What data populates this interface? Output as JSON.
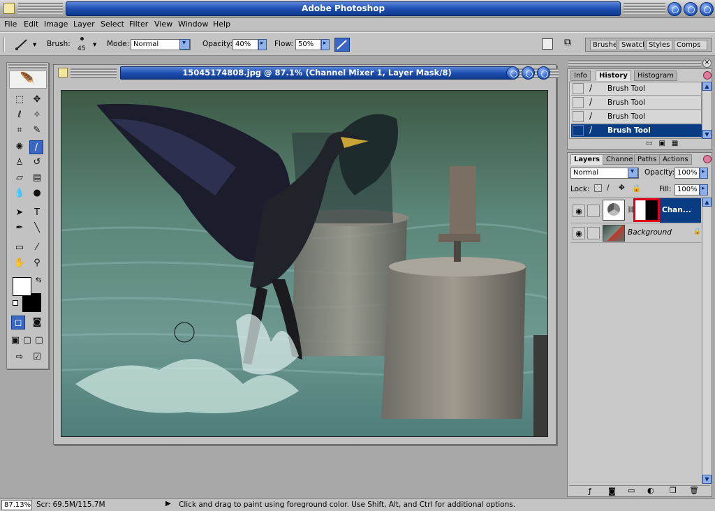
{
  "app": {
    "title": "Adobe Photoshop"
  },
  "menu": [
    "File",
    "Edit",
    "Image",
    "Layer",
    "Select",
    "Filter",
    "View",
    "Window",
    "Help"
  ],
  "options": {
    "brush_label": "Brush:",
    "brush_size": "45",
    "mode_label": "Mode:",
    "mode_value": "Normal",
    "opacity_label": "Opacity:",
    "opacity_value": "40%",
    "flow_label": "Flow:",
    "flow_value": "50%",
    "palette_tabs": [
      "Brushes",
      "Swatch",
      "Styles",
      "Comps"
    ]
  },
  "document": {
    "title": "15045174808.jpg @ 87.1% (Channel Mixer 1, Layer Mask/8)"
  },
  "history_panel": {
    "tabs": [
      "Info",
      "History",
      "Histogram"
    ],
    "items": [
      "Brush Tool",
      "Brush Tool",
      "Brush Tool",
      "Brush Tool"
    ]
  },
  "layers_panel": {
    "tabs": [
      "Layers",
      "Channels",
      "Paths",
      "Actions"
    ],
    "blend_mode": "Normal",
    "opacity_label": "Opacity:",
    "opacity_value": "100%",
    "lock_label": "Lock:",
    "fill_label": "Fill:",
    "fill_value": "100%",
    "layers": [
      {
        "name": "Chan..."
      },
      {
        "name": "Background"
      }
    ]
  },
  "status": {
    "zoom": "87.13%",
    "scratch": "Scr: 69.5M/115.7M",
    "hint": "Click and drag to paint using foreground color.  Use Shift, Alt, and Ctrl for additional options."
  },
  "colors": {
    "title_blue": "#1d4fb3",
    "selection": "#0a3c84",
    "mask_highlight": "#e0001a"
  },
  "icons": [
    "brush-icon",
    "eye-icon",
    "lock-icon",
    "trash-icon",
    "new-layer-icon",
    "folder-icon"
  ]
}
